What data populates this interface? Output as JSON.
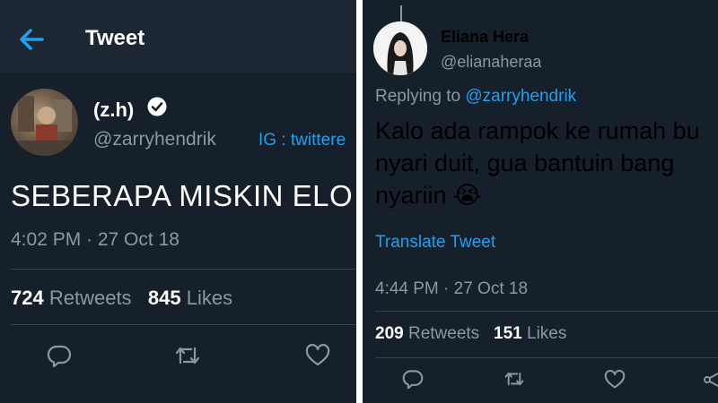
{
  "left_tweet": {
    "header_title": "Tweet",
    "name": "(z.h)",
    "handle": "@zarryhendrik",
    "bio_link": "IG : twittere",
    "text": "SEBERAPA MISKIN ELO",
    "timestamp": "4:02 PM · 27 Oct 18",
    "retweets_count": "724",
    "retweets_label": "Retweets",
    "likes_count": "845",
    "likes_label": "Likes"
  },
  "right_tweet": {
    "name": "Eliana Hera",
    "handle": "@elianaheraa",
    "replying_prefix": "Replying to ",
    "replying_to": "@zarryhendrik",
    "text_line1": "Kalo ada rampok ke rumah bu",
    "text_line2": "nyari duit, gua bantuin bang",
    "text_line3": "nyariin 😭",
    "translate_label": "Translate Tweet",
    "timestamp": "4:44 PM · 27 Oct 18",
    "retweets_count": "209",
    "retweets_label": "Retweets",
    "likes_count": "151",
    "likes_label": "Likes"
  },
  "icons": [
    "back-arrow-icon",
    "verified-badge-icon",
    "reply-icon",
    "retweet-icon",
    "like-icon",
    "share-icon"
  ],
  "colors": {
    "background": "#15202b",
    "accent": "#1da1f2",
    "muted": "#8899a6",
    "divider": "#38444d"
  }
}
